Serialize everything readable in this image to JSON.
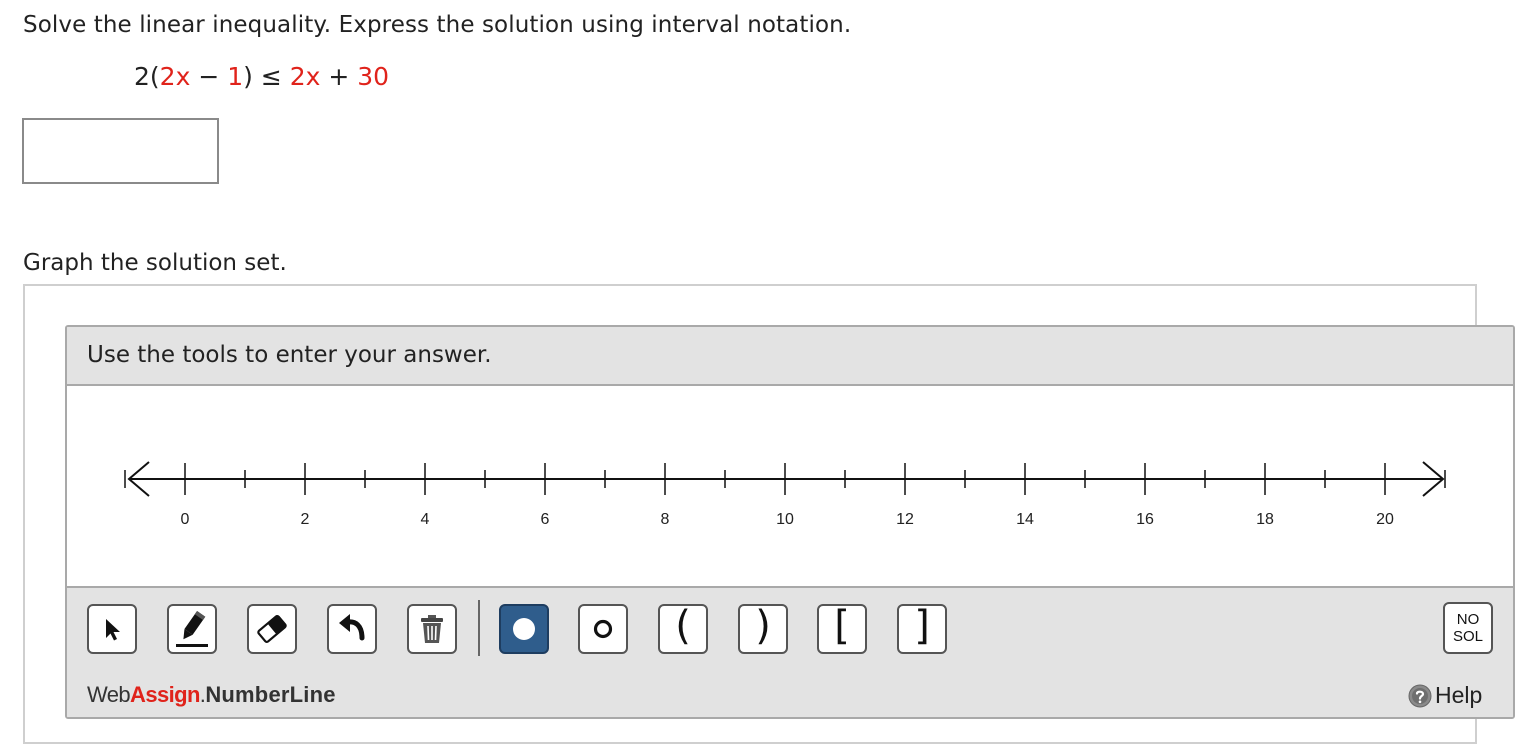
{
  "question": {
    "prompt": "Solve the linear inequality. Express the solution using interval notation.",
    "inequality": {
      "p1": "2(",
      "p2": "2x",
      "p3": " − ",
      "p4": "1",
      "p5": ") ≤ ",
      "p6": "2x",
      "p7": " + ",
      "p8": "30"
    },
    "answer_value": "",
    "graph_prompt": "Graph the solution set."
  },
  "widget": {
    "instructions": "Use the tools to enter your answer.",
    "numberline": {
      "min": 0,
      "max": 20,
      "labels": [
        "0",
        "2",
        "4",
        "6",
        "8",
        "10",
        "12",
        "14",
        "16",
        "18",
        "20"
      ]
    },
    "tools": [
      {
        "name": "pointer-tool",
        "icon": "arrow-cursor-icon",
        "selected": false
      },
      {
        "name": "pencil-tool",
        "icon": "pencil-icon",
        "selected": false
      },
      {
        "name": "eraser-tool",
        "icon": "eraser-icon",
        "selected": false
      },
      {
        "name": "undo-tool",
        "icon": "undo-arrow-icon",
        "selected": false
      },
      {
        "name": "trash-tool",
        "icon": "trash-can-icon",
        "selected": false
      },
      {
        "name": "closed-point-tool",
        "icon": "filled-circle-icon",
        "selected": true
      },
      {
        "name": "open-point-tool",
        "icon": "open-circle-icon",
        "selected": false
      },
      {
        "name": "open-left-paren-tool",
        "label": "(",
        "selected": false
      },
      {
        "name": "open-right-paren-tool",
        "label": ")",
        "selected": false
      },
      {
        "name": "closed-left-bracket-tool",
        "label": "[",
        "selected": false
      },
      {
        "name": "closed-right-bracket-tool",
        "label": "]",
        "selected": false
      }
    ],
    "no_solution": {
      "line1": "NO",
      "line2": "SOL"
    },
    "footer": {
      "brand_web": "Web",
      "brand_assign": "Assign",
      "brand_dot": ".",
      "brand_product": "NumberLine",
      "help_label": "Help"
    },
    "colors": {
      "selected_tool": "#2f5d8c",
      "accent_red": "#e0231b",
      "panel_gray": "#e3e3e3"
    }
  }
}
